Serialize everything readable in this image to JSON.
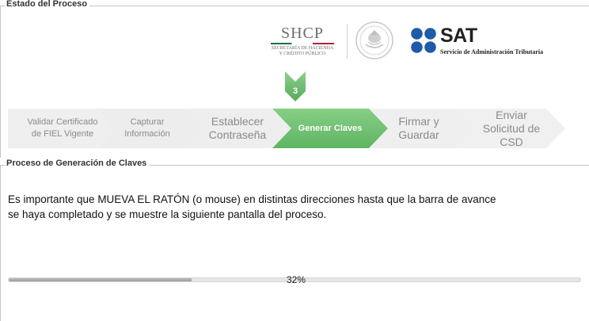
{
  "sections": {
    "estado_title": "Estado del Proceso",
    "proceso_title": "Proceso de Generación de Claves"
  },
  "logos": {
    "shcp_name": "SHCP",
    "shcp_sub_line1": "SECRETARÍA DE HACIENDA",
    "shcp_sub_line2": "Y CRÉDITO PÚBLICO",
    "sat_name": "SAT",
    "sat_sub": "Servicio de Administración Tributaria"
  },
  "marker": {
    "step_number": "3",
    "color": "#66bb6a"
  },
  "steps": [
    {
      "line1": "Validar Certificado",
      "line2": "de FIEL Vigente",
      "line3": "",
      "active": false
    },
    {
      "line1": "Capturar",
      "line2": "Información",
      "line3": "",
      "active": false
    },
    {
      "line1": "Establecer",
      "line2": "Contraseña",
      "line3": "",
      "active": false
    },
    {
      "line1": "Generar Claves",
      "line2": "",
      "line3": "",
      "active": true
    },
    {
      "line1": "Firmar y",
      "line2": "Guardar",
      "line3": "",
      "active": false
    },
    {
      "line1": "Enviar",
      "line2": "Solicitud de",
      "line3": "CSD",
      "active": false
    }
  ],
  "colors": {
    "active_step": "#6bbf6e",
    "inactive_step": "#efefef",
    "sat_blue": "#1e5ba8"
  },
  "description": {
    "line1": "Es importante que MUEVA EL RATÓN (o mouse) en distintas direcciones hasta que la barra de avance",
    "line2": "se haya completado y se muestre la siguiente pantalla del proceso."
  },
  "progress": {
    "value": 0.32,
    "label": "32%"
  }
}
